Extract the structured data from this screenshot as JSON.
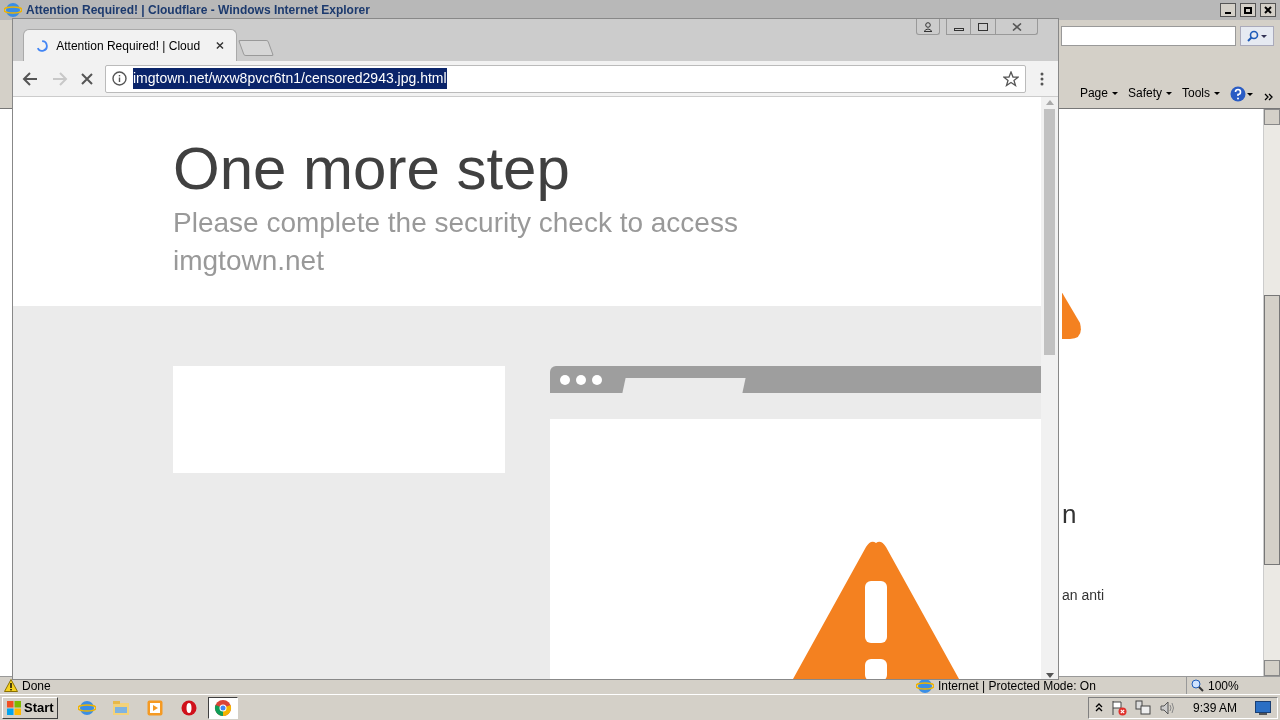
{
  "background_window": {
    "title": "Attention Required! | Cloudflare - Windows Internet Explorer",
    "command_bar": [
      {
        "label": "Page"
      },
      {
        "label": "Safety"
      },
      {
        "label": "Tools"
      }
    ],
    "page_fragments": [
      "n",
      "an anti"
    ],
    "status": "Done",
    "zone": "Internet | Protected Mode: On",
    "zoom": "100%"
  },
  "browser": {
    "tab": {
      "title": "Attention Required! | Cloud",
      "loading": true
    },
    "url": "imgtown.net/wxw8pvcr6tn1/censored2943.jpg.html",
    "url_selected": true,
    "forward_disabled": true,
    "page": {
      "heading": "One more step",
      "subheading": "Please complete the security check to access",
      "domain": "imgtown.net"
    }
  },
  "taskbar": {
    "start": "Start",
    "apps": [
      {
        "kind": "ie",
        "selected": false
      },
      {
        "kind": "explorer",
        "selected": false
      },
      {
        "kind": "media",
        "selected": false
      },
      {
        "kind": "opera",
        "selected": false
      },
      {
        "kind": "chrome",
        "selected": true
      }
    ],
    "clock": "9:39 AM"
  }
}
